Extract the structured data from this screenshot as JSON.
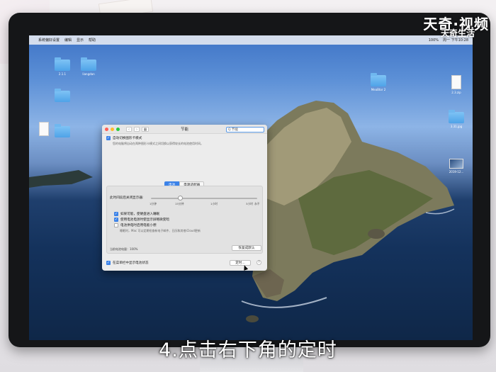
{
  "watermark": {
    "brand": "天奇·视频",
    "sub": "天奇生活"
  },
  "menubar": {
    "apple": "",
    "items": [
      "系统偏好设置",
      "编辑",
      "显示",
      "帮助"
    ],
    "right": [
      "100%",
      "周一 下午10:28"
    ]
  },
  "desktop_icons": [
    {
      "label": "2.1.1"
    },
    {
      "label": "liangdan"
    },
    {
      "label": "MeaBtor 2"
    },
    {
      "label": "2.3.zip"
    },
    {
      "label": "3.31.jpg"
    },
    {
      "label": "2019-12..."
    }
  ],
  "window": {
    "title": "节能",
    "search": "Q 节能",
    "auto_switch": {
      "label": "自动切换图形卡模式",
      "desc": "您的电脑将自动在两种图形卡模式之间切换以获得较长的电池使用时间。"
    },
    "tabs": [
      "电池",
      "电源适配器"
    ],
    "slider_label": "此时间段后关闭显示器:",
    "ticks": [
      "1分钟",
      "15分钟",
      "1小时",
      "3小时",
      "永不"
    ],
    "options": [
      {
        "label": "如果可能，使硬盘进入睡眠",
        "checked": true
      },
      {
        "label": "使用电池电源时使显示屏略微变暗",
        "checked": true
      },
      {
        "label": "电池供电时启用电能小憩",
        "checked": false,
        "desc": "睡眠时，Mac 可以定期检查新电子邮件、日历和其他iCloud更新"
      }
    ],
    "battery_level": "当前电池电量：100%",
    "restore_button": "恢复成默认",
    "show_status": "在菜单栏中显示电池状态",
    "schedule_button": "定时...",
    "help": "?"
  },
  "caption": "4.点击右下角的定时"
}
